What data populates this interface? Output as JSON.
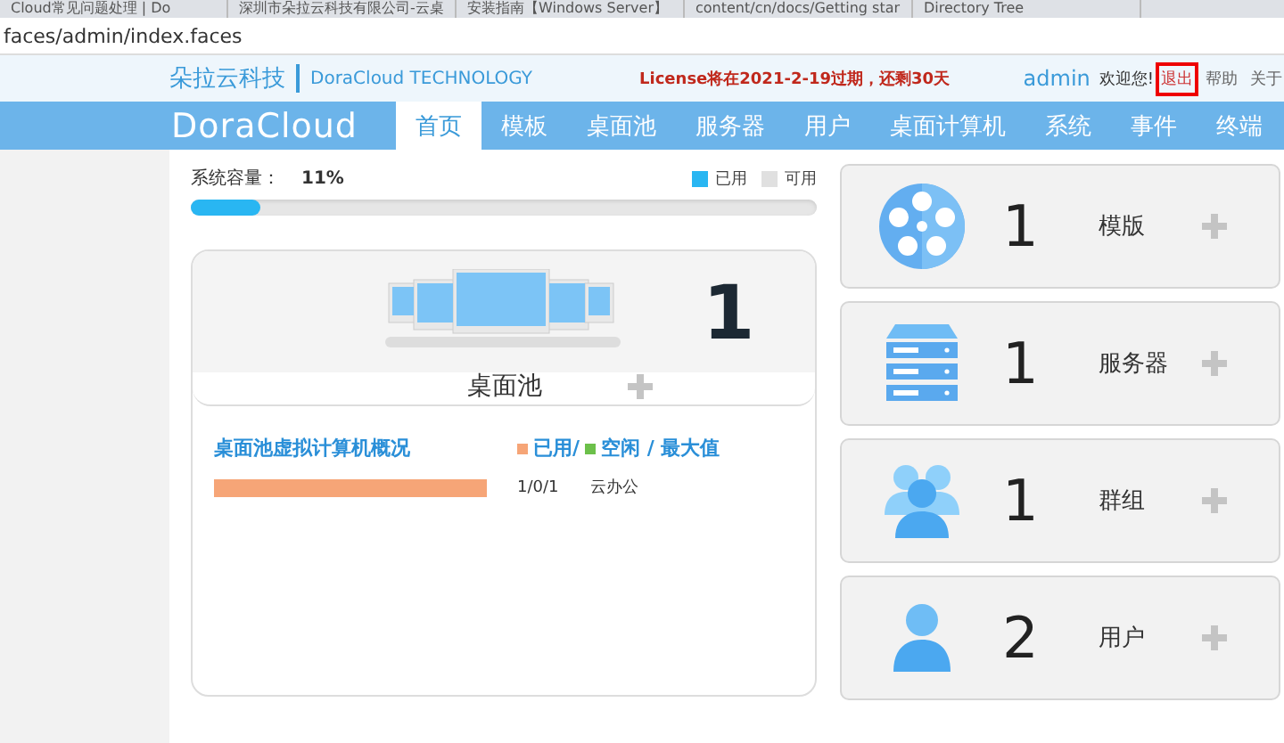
{
  "browser_tabs": [
    {
      "label": "Cloud常见问题处理 | Do"
    },
    {
      "label": "深圳市朵拉云科技有限公司-云桌"
    },
    {
      "label": "安装指南【Windows Server】"
    },
    {
      "label": "content/cn/docs/Getting star"
    },
    {
      "label": "Directory Tree"
    }
  ],
  "address_bar": {
    "url": "faces/admin/index.faces"
  },
  "header": {
    "brand": "朵拉云科技",
    "subtitle": "DoraCloud TECHNOLOGY",
    "license_notice": "License将在2021-2-19过期，还剩30天",
    "user": "admin",
    "welcome": "欢迎您!",
    "links": [
      {
        "label": "退出",
        "highlighted": true
      },
      {
        "label": "帮助",
        "highlighted": false
      },
      {
        "label": "关于",
        "highlighted": false
      }
    ]
  },
  "nav": {
    "logo": "DoraCloud",
    "items": [
      {
        "label": "首页",
        "selected": true
      },
      {
        "label": "模板",
        "selected": false
      },
      {
        "label": "桌面池",
        "selected": false
      },
      {
        "label": "服务器",
        "selected": false
      },
      {
        "label": "用户",
        "selected": false
      },
      {
        "label": "桌面计算机",
        "selected": false
      },
      {
        "label": "系统",
        "selected": false
      },
      {
        "label": "事件",
        "selected": false
      },
      {
        "label": "终端",
        "selected": false
      }
    ]
  },
  "capacity": {
    "label": "系统容量：",
    "value": "11%",
    "level": 0.11,
    "legend": [
      {
        "label": "已用",
        "color": "#29b6f2"
      },
      {
        "label": "可用",
        "color": "#e0e0e0"
      }
    ]
  },
  "pool_card": {
    "count": "1",
    "title": "桌面池"
  },
  "pool_summary": {
    "title": "桌面池虚拟计算机概况",
    "legend": [
      {
        "label": "已用/",
        "color": "#f6a577"
      },
      {
        "label": "空闲 / 最大值",
        "color": "#6cc04a"
      }
    ],
    "rows": [
      {
        "level": 1.0,
        "reading": "1/0/1",
        "name": "云办公"
      }
    ]
  },
  "stats": [
    {
      "kind": "template",
      "count": "1",
      "label": "模版"
    },
    {
      "kind": "server",
      "count": "1",
      "label": "服务器"
    },
    {
      "kind": "group",
      "count": "1",
      "label": "群组"
    },
    {
      "kind": "user",
      "count": "2",
      "label": "用户"
    }
  ]
}
